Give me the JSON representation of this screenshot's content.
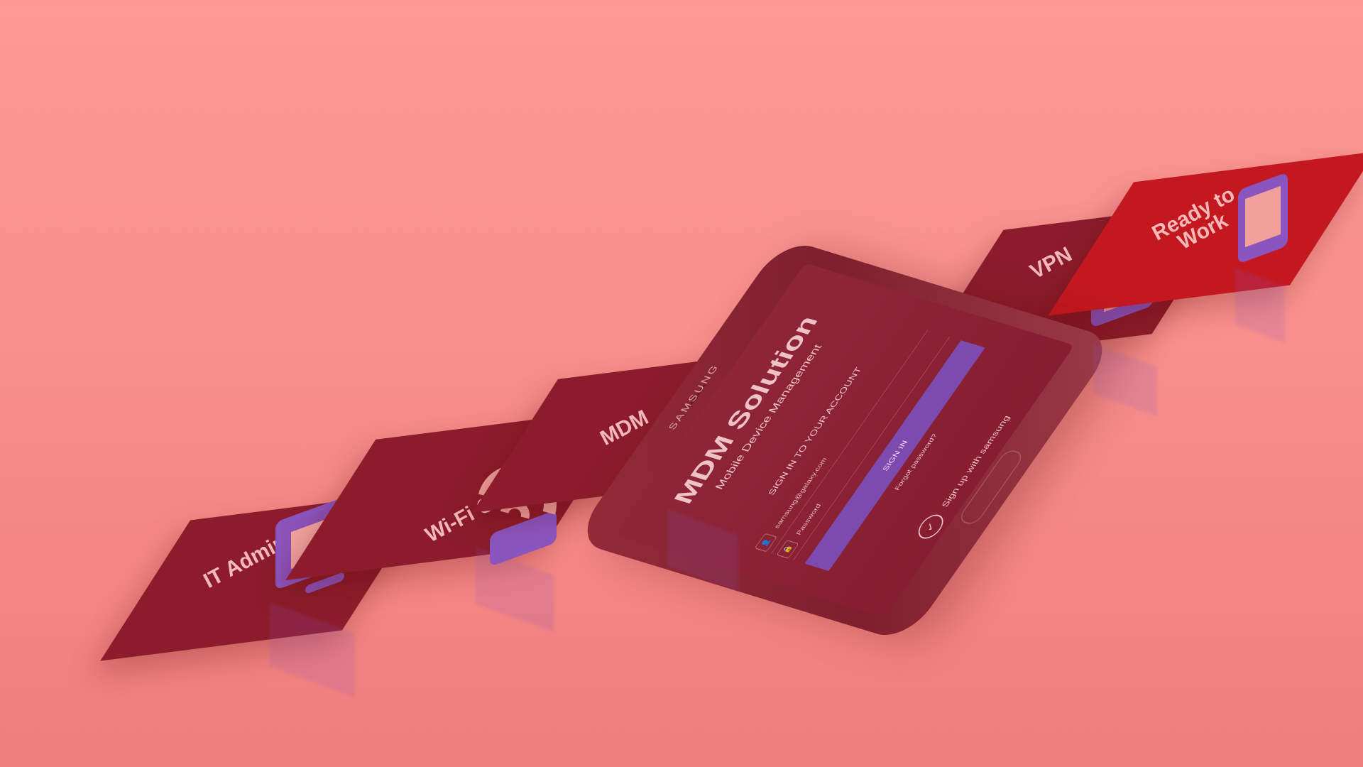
{
  "colors": {
    "background": "#f88f8c",
    "tile": "#8c1c2b",
    "tile_highlight": "#c3181f",
    "icon": "#8c52b8"
  },
  "phone": {
    "brand": "SAMSUNG",
    "screen": {
      "title": "MDM Solution",
      "subtitle": "Mobile Device Management",
      "section": "SIGN IN TO YOUR ACCOUNT",
      "email": "samsung@galaxy.com",
      "password": "Password",
      "button": "SIGN IN",
      "forgot": "Forgot password?",
      "signup": "Sign up with samsung"
    }
  },
  "tiles": [
    {
      "label": "IT Admin",
      "icon": "monitor-icon"
    },
    {
      "label": "Wi-Fi Connect",
      "icon": "wifi-icon"
    },
    {
      "label": "MDM",
      "icon": "arrow-box-icon"
    },
    {
      "label": "VPN",
      "icon": "lock-icon"
    },
    {
      "label": "Ready to Work",
      "icon": "phone-icon"
    }
  ]
}
